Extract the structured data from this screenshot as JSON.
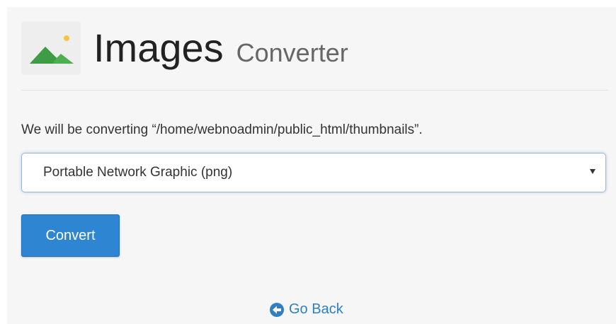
{
  "header": {
    "icon": "landscape-image-icon",
    "title": "Images",
    "subtitle": "Converter"
  },
  "message": "We will be converting “/home/webnoadmin/public_html/thumbnails”.",
  "format_select": {
    "selected": "Portable Network Graphic (png)"
  },
  "convert_button": {
    "label": "Convert"
  },
  "go_back": {
    "icon": "arrow-left-circle-icon",
    "label": "Go Back"
  },
  "colors": {
    "accent": "#2e86d3",
    "link": "#2f7fc4",
    "icon_green": "#4caf50",
    "icon_sun": "#f6c343"
  }
}
